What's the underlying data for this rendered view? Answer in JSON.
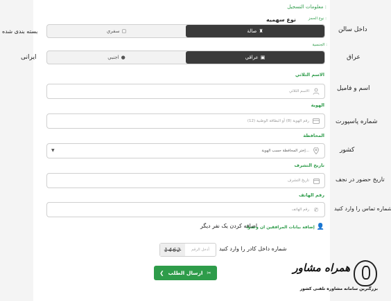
{
  "annotations": {
    "category": "داخل سالن",
    "package": "بسته بندی شده",
    "nationality": "عراق",
    "iranian": "ایرانی",
    "full_name": "اسم و فامیل",
    "passport": "شماره پاسپورت",
    "country": "کشور",
    "arrival": "تاریخ حضور در نجف",
    "phone": "شماره تماس را وارد کنید",
    "add_companion": "اضافه کردن یک نفر دیگر",
    "captcha": "شماره داخل کادر را وارد کنید"
  },
  "form": {
    "section_title": "معلومات التسجيل :",
    "category_label": "نوع الحجز :",
    "category_label_fa": "نوع سهمیه",
    "category_options": [
      {
        "label": "صالة",
        "icon": "hall-icon",
        "active": true
      },
      {
        "label": "سفري",
        "icon": "box-icon",
        "active": false
      }
    ],
    "nationality_label": "الجنسية :",
    "nationality_options": [
      {
        "label": "عراقي",
        "icon": "iraq-flag-icon",
        "active": true
      },
      {
        "label": "اجنبي",
        "icon": "globe-icon",
        "active": false
      }
    ],
    "name_label": "الاسم الثلاثي",
    "name_placeholder": "الاسم الثلاثي",
    "id_label": "الهوية",
    "id_placeholder": "رقم الهوية (8) أو البطاقة الوطنية (12)",
    "province_label": "المحافظة",
    "province_placeholder": "إختر المحافظة حسب الهوية...",
    "date_label": "تاريخ التشرف",
    "date_placeholder": "تاريخ التشرف",
    "phone_label": "رقم الهاتف",
    "phone_placeholder": "رقم الهاتف",
    "add_companion_label": "إضافة بيانات المرافقين ان وجدوا",
    "captcha_placeholder": "أدخل الرقم",
    "captcha_code": "1462",
    "submit_label": "ارسال الطلب"
  },
  "branding": {
    "name": "همراه مشاور",
    "tagline": "بزرگترین سامانه مشاوره تلفنی کشور"
  }
}
